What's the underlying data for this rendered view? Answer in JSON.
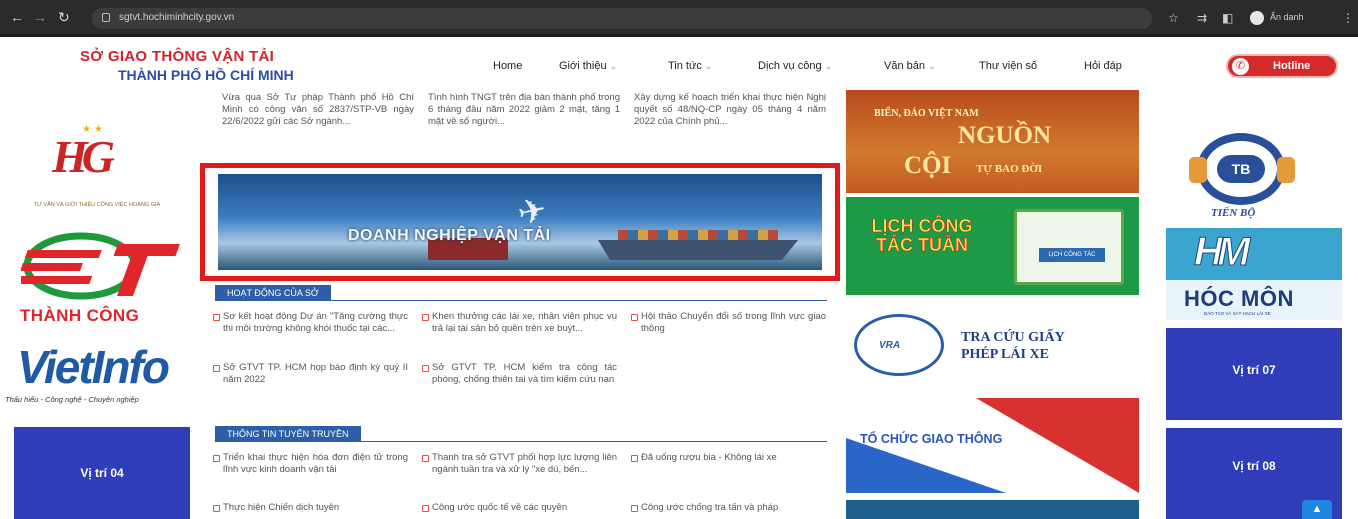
{
  "browser": {
    "url": "sgtvt.hochiminhcity.gov.vn",
    "profile_label": "Ẩn danh"
  },
  "header": {
    "logo_line1": "SỞ GIAO THÔNG VẬN TẢI",
    "logo_line2": "THÀNH PHỐ HỒ CHÍ MINH",
    "menu": [
      {
        "label": "Home"
      },
      {
        "label": "Giới thiệu"
      },
      {
        "label": "Tin tức"
      },
      {
        "label": "Dịch vụ công"
      },
      {
        "label": "Văn bản"
      },
      {
        "label": "Thư viện số"
      },
      {
        "label": "Hỏi đáp"
      }
    ],
    "hotline": "Hotline",
    "brand_colors": {
      "red": "#d3242a",
      "blue": "#2b4ea2"
    }
  },
  "top_news": [
    {
      "text": "Vừa qua Sở Tư pháp Thành phố Hồ Chí Minh có công văn số 2837/STP-VB ngày 22/6/2022 gửi các Sở ngành..."
    },
    {
      "text": "Tình hình TNGT trên địa bàn thành phố trong 6 tháng đầu năm 2022 giảm 2 mặt, tăng 1 mặt về số người..."
    },
    {
      "text": "Xây dựng kế hoạch triển khai thực hiện Nghị quyết số 48/NQ-CP ngày 05 tháng 4 năm 2022 của Chính phủ..."
    }
  ],
  "main_banner": {
    "title": "DOANH NGHIỆP VẬN TẢI"
  },
  "sections": [
    {
      "heading": "HOẠT ĐỘNG CỦA SỞ",
      "items": [
        {
          "text": "Sơ kết hoạt động Dự án \"Tăng cường thực thi môi trường không khói thuốc tại các..."
        },
        {
          "text": "Khen thưởng các lái xe, nhân viên phục vụ trả lại tài sản bỏ quên trên xe buýt..."
        },
        {
          "text": "Hội thảo Chuyển đổi số trong lĩnh vực giao thông"
        },
        {
          "text": "Sở GTVT TP. HCM họp báo định kỳ quý II năm 2022"
        },
        {
          "text": "Sở GTVT TP. HCM kiểm tra công tác phòng, chống thiên tai và tìm kiếm cứu nạn"
        }
      ]
    },
    {
      "heading": "THÔNG TIN TUYÊN TRUYỀN",
      "items": [
        {
          "text": "Triển khai thực hiện hóa đơn điện tử trong lĩnh vực kinh doanh vận tải"
        },
        {
          "text": "Thanh tra sở GTVT phối hợp lực lượng liên ngành tuần tra và xử lý \"xe dù, bến..."
        },
        {
          "text": "Đã uống rượu bia - Không lái xe"
        },
        {
          "text": "Thực hiện Chiến dịch tuyên"
        },
        {
          "text": "Công ước quốc tế về các quyền"
        },
        {
          "text": "Công ước chống tra tấn và pháp"
        }
      ]
    }
  ],
  "left_ads": {
    "hg_subtitle": "TƯ VẤN VÀ GIỚI THIỆU CÔNG VIỆC HOÀNG GIA",
    "thanh_cong": "THÀNH CÔNG",
    "vietinfo": "VietInfo",
    "vietinfo_tagline": "Thấu hiểu - Công nghệ - Chuyên nghiệp",
    "slot_04": "Vị trí 04"
  },
  "right_banners": {
    "bien_line1": "BIỂN, ĐẢO VIỆT NAM",
    "bien_line2": "NGUỒN",
    "bien_line3": "CỘI",
    "bien_line4": "TỰ BAO ĐỜI",
    "lich_text": "LỊCH CÔNG TÁC TUẦN",
    "lich_book_label": "LỊCH CÔNG TÁC",
    "tra_logo": "VRA",
    "tra_line1": "TRA CỨU GIẤY",
    "tra_line2": "PHÉP LÁI XE",
    "to_chuc": "TỔ CHỨC GIAO THÔNG"
  },
  "far_right_ads": {
    "tb_mark": "TB",
    "tb_name": "TIẾN BỘ",
    "hoc_mon": "HÓC MÔN",
    "hoc_mon_sub": "ĐÀO TẠO VÀ SÁT HẠCH LÁI XE",
    "slot_07": "Vị trí 07",
    "slot_08": "Vị trí 08"
  },
  "icons": [
    "back-icon",
    "forward-icon",
    "reload-icon",
    "lock-icon",
    "star-icon",
    "tab-search-icon",
    "sidebar-icon",
    "profile-icon",
    "menu-dots-icon",
    "phone-icon",
    "chevron-down-icon",
    "scroll-up-icon"
  ]
}
